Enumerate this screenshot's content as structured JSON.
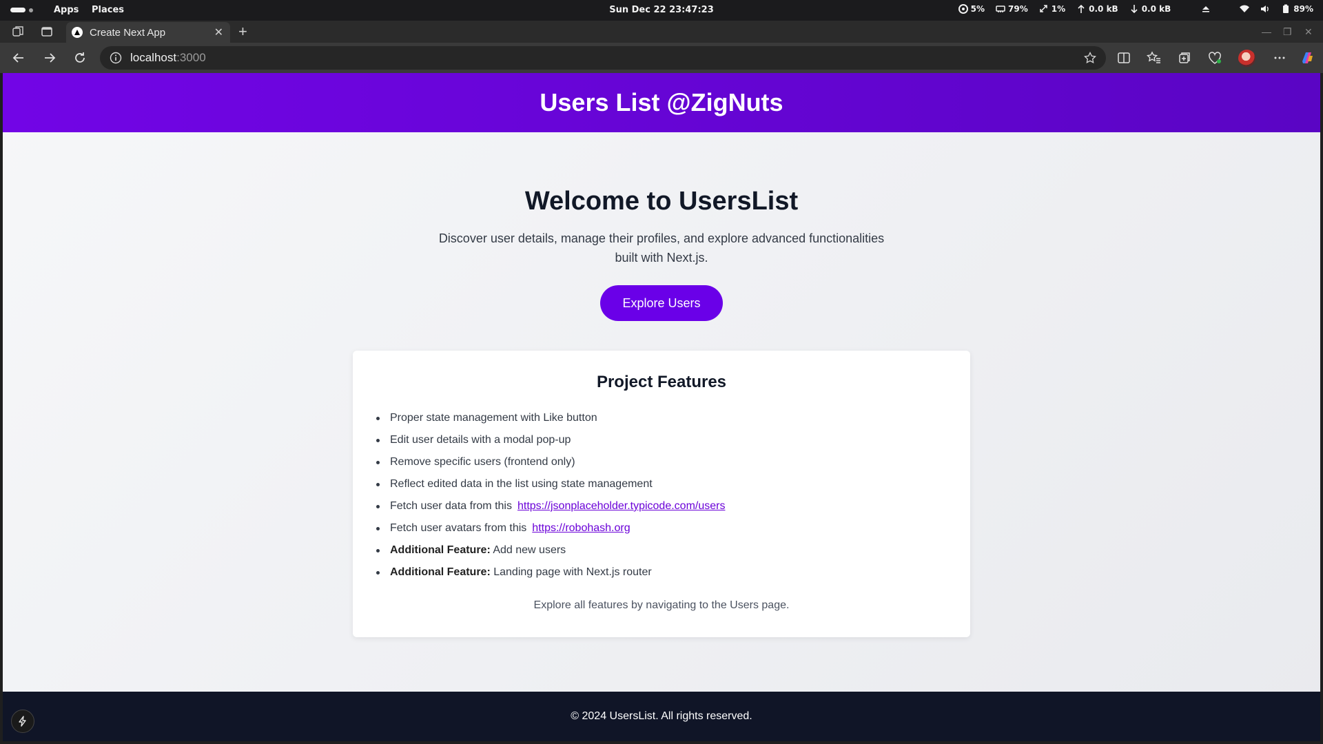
{
  "system_bar": {
    "menus": [
      "Apps",
      "Places"
    ],
    "clock": "Sun Dec 22  23:47:23",
    "indicators": [
      {
        "icon": "cpu-icon",
        "value": "5%"
      },
      {
        "icon": "memory-icon",
        "value": "79%"
      },
      {
        "icon": "swap-icon",
        "value": "1%"
      },
      {
        "icon": "upload-icon",
        "value": "0.0 kB"
      },
      {
        "icon": "download-icon",
        "value": "0.0 kB"
      }
    ],
    "battery": "89%"
  },
  "browser": {
    "tab_title": "Create Next App",
    "url_host": "localhost",
    "url_port": ":3000"
  },
  "page": {
    "header_title": "Users List @ZigNuts",
    "hero": {
      "title": "Welcome to UsersList",
      "description": "Discover user details, manage their profiles, and explore advanced functionalities built with Next.js.",
      "cta_label": "Explore Users"
    },
    "features": {
      "title": "Project Features",
      "items": [
        {
          "prefix": "",
          "text": "Proper state management with Like button",
          "link": ""
        },
        {
          "prefix": "",
          "text": "Edit user details with a modal pop-up",
          "link": ""
        },
        {
          "prefix": "",
          "text": "Remove specific users (frontend only)",
          "link": ""
        },
        {
          "prefix": "",
          "text": "Reflect edited data in the list using state management",
          "link": ""
        },
        {
          "prefix": "",
          "text": "Fetch user data from this",
          "link": "https://jsonplaceholder.typicode.com/users"
        },
        {
          "prefix": "",
          "text": "Fetch user avatars from this",
          "link": "https://robohash.org"
        },
        {
          "prefix": "Additional Feature:",
          "text": "Add new users",
          "link": ""
        },
        {
          "prefix": "Additional Feature:",
          "text": "Landing page with Next.js router",
          "link": ""
        }
      ],
      "note": "Explore all features by navigating to the Users page."
    },
    "footer": "© 2024 UsersList. All rights reserved."
  }
}
